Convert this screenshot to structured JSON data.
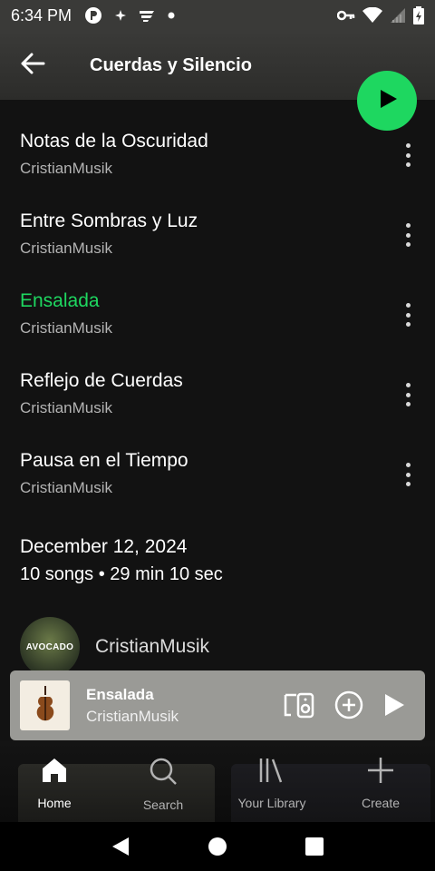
{
  "status_bar": {
    "time": "6:34 PM",
    "left_icons": [
      "podcast-app-icon",
      "pinwheel-icon",
      "flipboard-icon",
      "dot-icon"
    ],
    "right_icons": [
      "vpn-key-icon",
      "wifi-icon",
      "cell-signal-icon",
      "battery-icon"
    ]
  },
  "header": {
    "title": "Cuerdas y Silencio",
    "back_icon": "arrow-left-icon",
    "play_icon": "play-icon"
  },
  "tracks": [
    {
      "title": "Notas de la Oscuridad",
      "artist": "CristianMusik",
      "active": false
    },
    {
      "title": "Entre Sombras y Luz",
      "artist": "CristianMusik",
      "active": false
    },
    {
      "title": "Ensalada",
      "artist": "CristianMusik",
      "active": true
    },
    {
      "title": "Reflejo de Cuerdas",
      "artist": "CristianMusik",
      "active": false
    },
    {
      "title": "Pausa en el Tiempo",
      "artist": "CristianMusik",
      "active": false
    }
  ],
  "meta": {
    "date": "December 12, 2024",
    "info": "10 songs • 29 min 10 sec"
  },
  "artist": {
    "avatar_text": "AVOCADO",
    "name": "CristianMusik"
  },
  "now_playing": {
    "title": "Ensalada",
    "artist": "CristianMusik",
    "controls": [
      "connect-device-icon",
      "add-icon",
      "play-icon"
    ]
  },
  "bottom_nav": [
    {
      "label": "Home",
      "icon": "home-icon",
      "active": true
    },
    {
      "label": "Search",
      "icon": "search-icon",
      "active": false
    },
    {
      "label": "Your Library",
      "icon": "library-icon",
      "active": false
    },
    {
      "label": "Create",
      "icon": "plus-icon",
      "active": false
    }
  ],
  "colors": {
    "accent": "#1ed760",
    "background": "#121212",
    "now_playing_bg": "#9a9a96",
    "secondary_text": "#b3b3b3"
  }
}
